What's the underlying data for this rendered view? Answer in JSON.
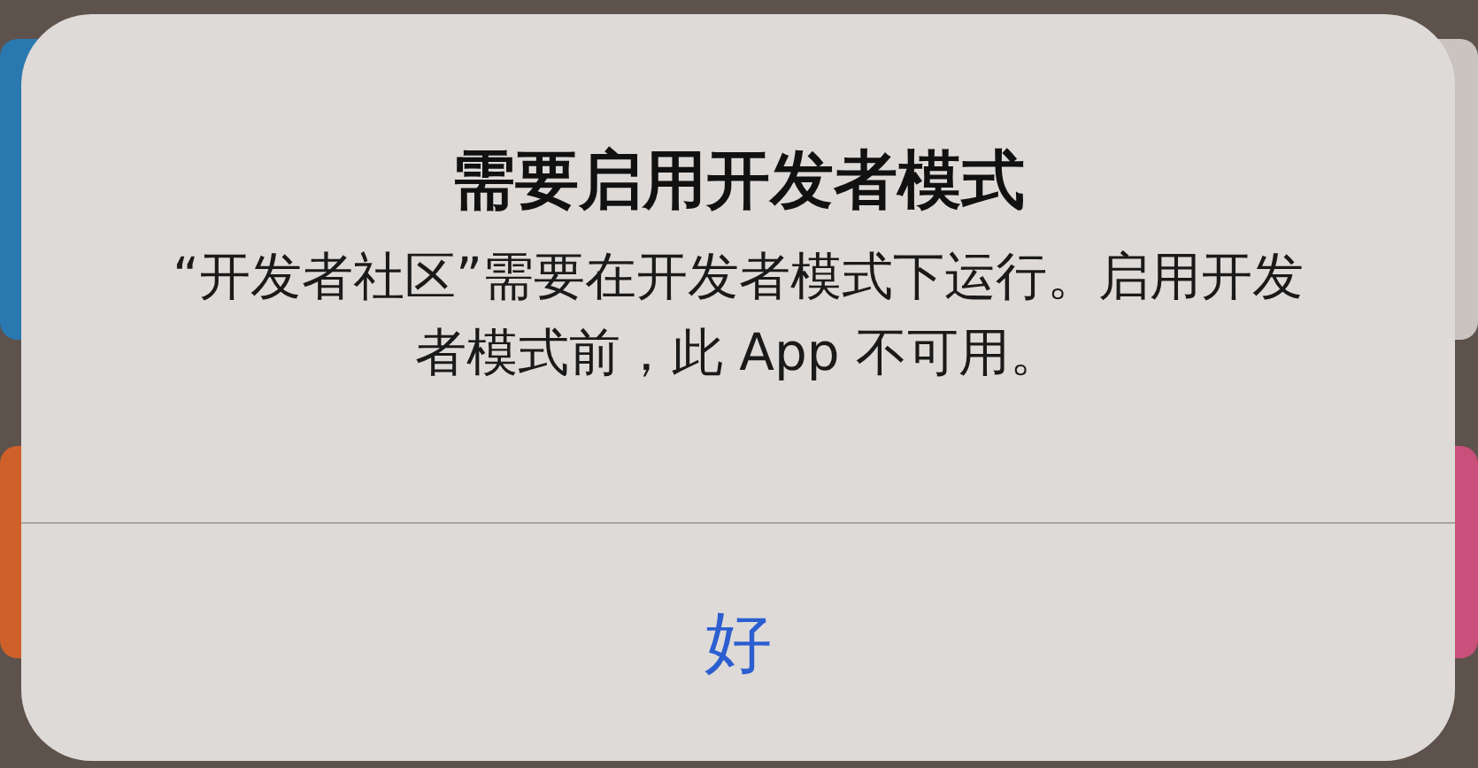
{
  "alert": {
    "title": "需要启用开发者模式",
    "message": "“开发者社区”需要在开发者模式下运行。启用开发者模式前，此 App 不可用。",
    "buttons": [
      {
        "label": "好",
        "kind": "default"
      }
    ]
  }
}
